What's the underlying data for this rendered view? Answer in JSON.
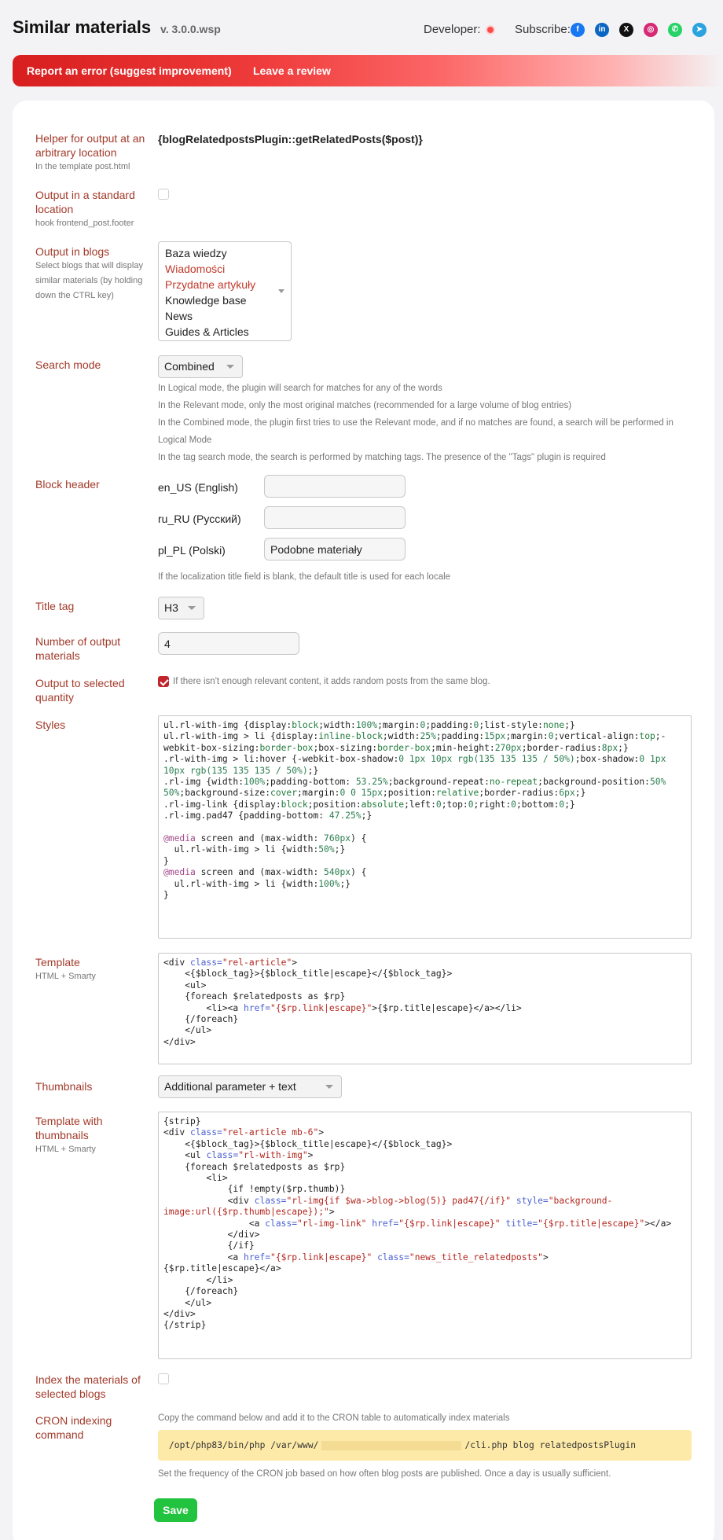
{
  "header": {
    "title": "Similar materials",
    "version": "v. 3.0.0.wsp",
    "developer_label": "Developer:",
    "subscribe_label": "Subscribe:",
    "social": [
      {
        "icon": "facebook-icon",
        "glyph": "f",
        "color": "#1877f2"
      },
      {
        "icon": "linkedin-icon",
        "glyph": "in",
        "color": "#0a66c2"
      },
      {
        "icon": "x-icon",
        "glyph": "X",
        "color": "#111111"
      },
      {
        "icon": "instagram-icon",
        "glyph": "◎",
        "color": "#d62976"
      },
      {
        "icon": "whatsapp-icon",
        "glyph": "✆",
        "color": "#25d366"
      },
      {
        "icon": "telegram-icon",
        "glyph": "➤",
        "color": "#2aa3de"
      }
    ]
  },
  "banner": {
    "report_error": "Report an error (suggest improvement)",
    "leave_review": "Leave a review"
  },
  "helper": {
    "label": "Helper for output at an arbitrary location",
    "hint": "In the template post.html",
    "value": "{blogRelatedpostsPlugin::getRelatedPosts($post)}"
  },
  "standard_location": {
    "label": "Output in a standard location",
    "hint": "hook frontend_post.footer",
    "checked": false
  },
  "blogs": {
    "label": "Output in blogs",
    "hint": "Select blogs that will display similar materials (by holding down the CTRL key)",
    "options": [
      {
        "name": "Baza wiedzy",
        "selected": false
      },
      {
        "name": "Wiadomości",
        "selected": true
      },
      {
        "name": "Przydatne artykuły",
        "selected": true
      },
      {
        "name": "Knowledge base",
        "selected": false
      },
      {
        "name": "News",
        "selected": false
      },
      {
        "name": "Guides & Articles",
        "selected": false
      }
    ]
  },
  "search_mode": {
    "label": "Search mode",
    "selected": "Combined",
    "notes": [
      "In Logical mode, the plugin will search for matches for any of the words",
      "In the Relevant mode, only the most original matches (recommended for a large volume of blog entries)",
      "In the Combined mode, the plugin first tries to use the Relevant mode, and if no matches are found, a search will be performed in Logical Mode",
      "In the tag search mode, the search is performed by matching tags. The presence of the \"Tags\" plugin is required"
    ]
  },
  "block_header": {
    "label": "Block header",
    "locales": [
      {
        "name": "en_US (English)",
        "value": ""
      },
      {
        "name": "ru_RU (Русский)",
        "value": ""
      },
      {
        "name": "pl_PL (Polski)",
        "value": "Podobne materiały"
      }
    ],
    "note": "If the localization title field is blank, the default title is used for each locale"
  },
  "title_tag": {
    "label": "Title tag",
    "selected": "H3"
  },
  "output_count": {
    "label": "Number of output materials",
    "value": "4"
  },
  "selected_quantity": {
    "label": "Output to selected quantity",
    "checked": true,
    "note": "If there isn't enough relevant content, it adds random posts from the same blog."
  },
  "styles": {
    "label": "Styles"
  },
  "template": {
    "label": "Template",
    "hint": "HTML + Smarty"
  },
  "thumbnails": {
    "label": "Thumbnails",
    "selected": "Additional parameter + text"
  },
  "template_thumbs": {
    "label": "Template with thumbnails",
    "hint": "HTML + Smarty"
  },
  "index_materials": {
    "label": "Index the materials of selected blogs",
    "checked": false
  },
  "cron": {
    "label": "CRON indexing command",
    "note_top": "Copy the command below and add it to the CRON table to automatically index materials",
    "command_prefix": "/opt/php83/bin/php /var/www/",
    "command_suffix": "/cli.php blog relatedpostsPlugin",
    "note_bottom": "Set the frequency of the CRON job based on how often blog posts are published. Once a day is usually sufficient."
  },
  "save_label": "Save"
}
